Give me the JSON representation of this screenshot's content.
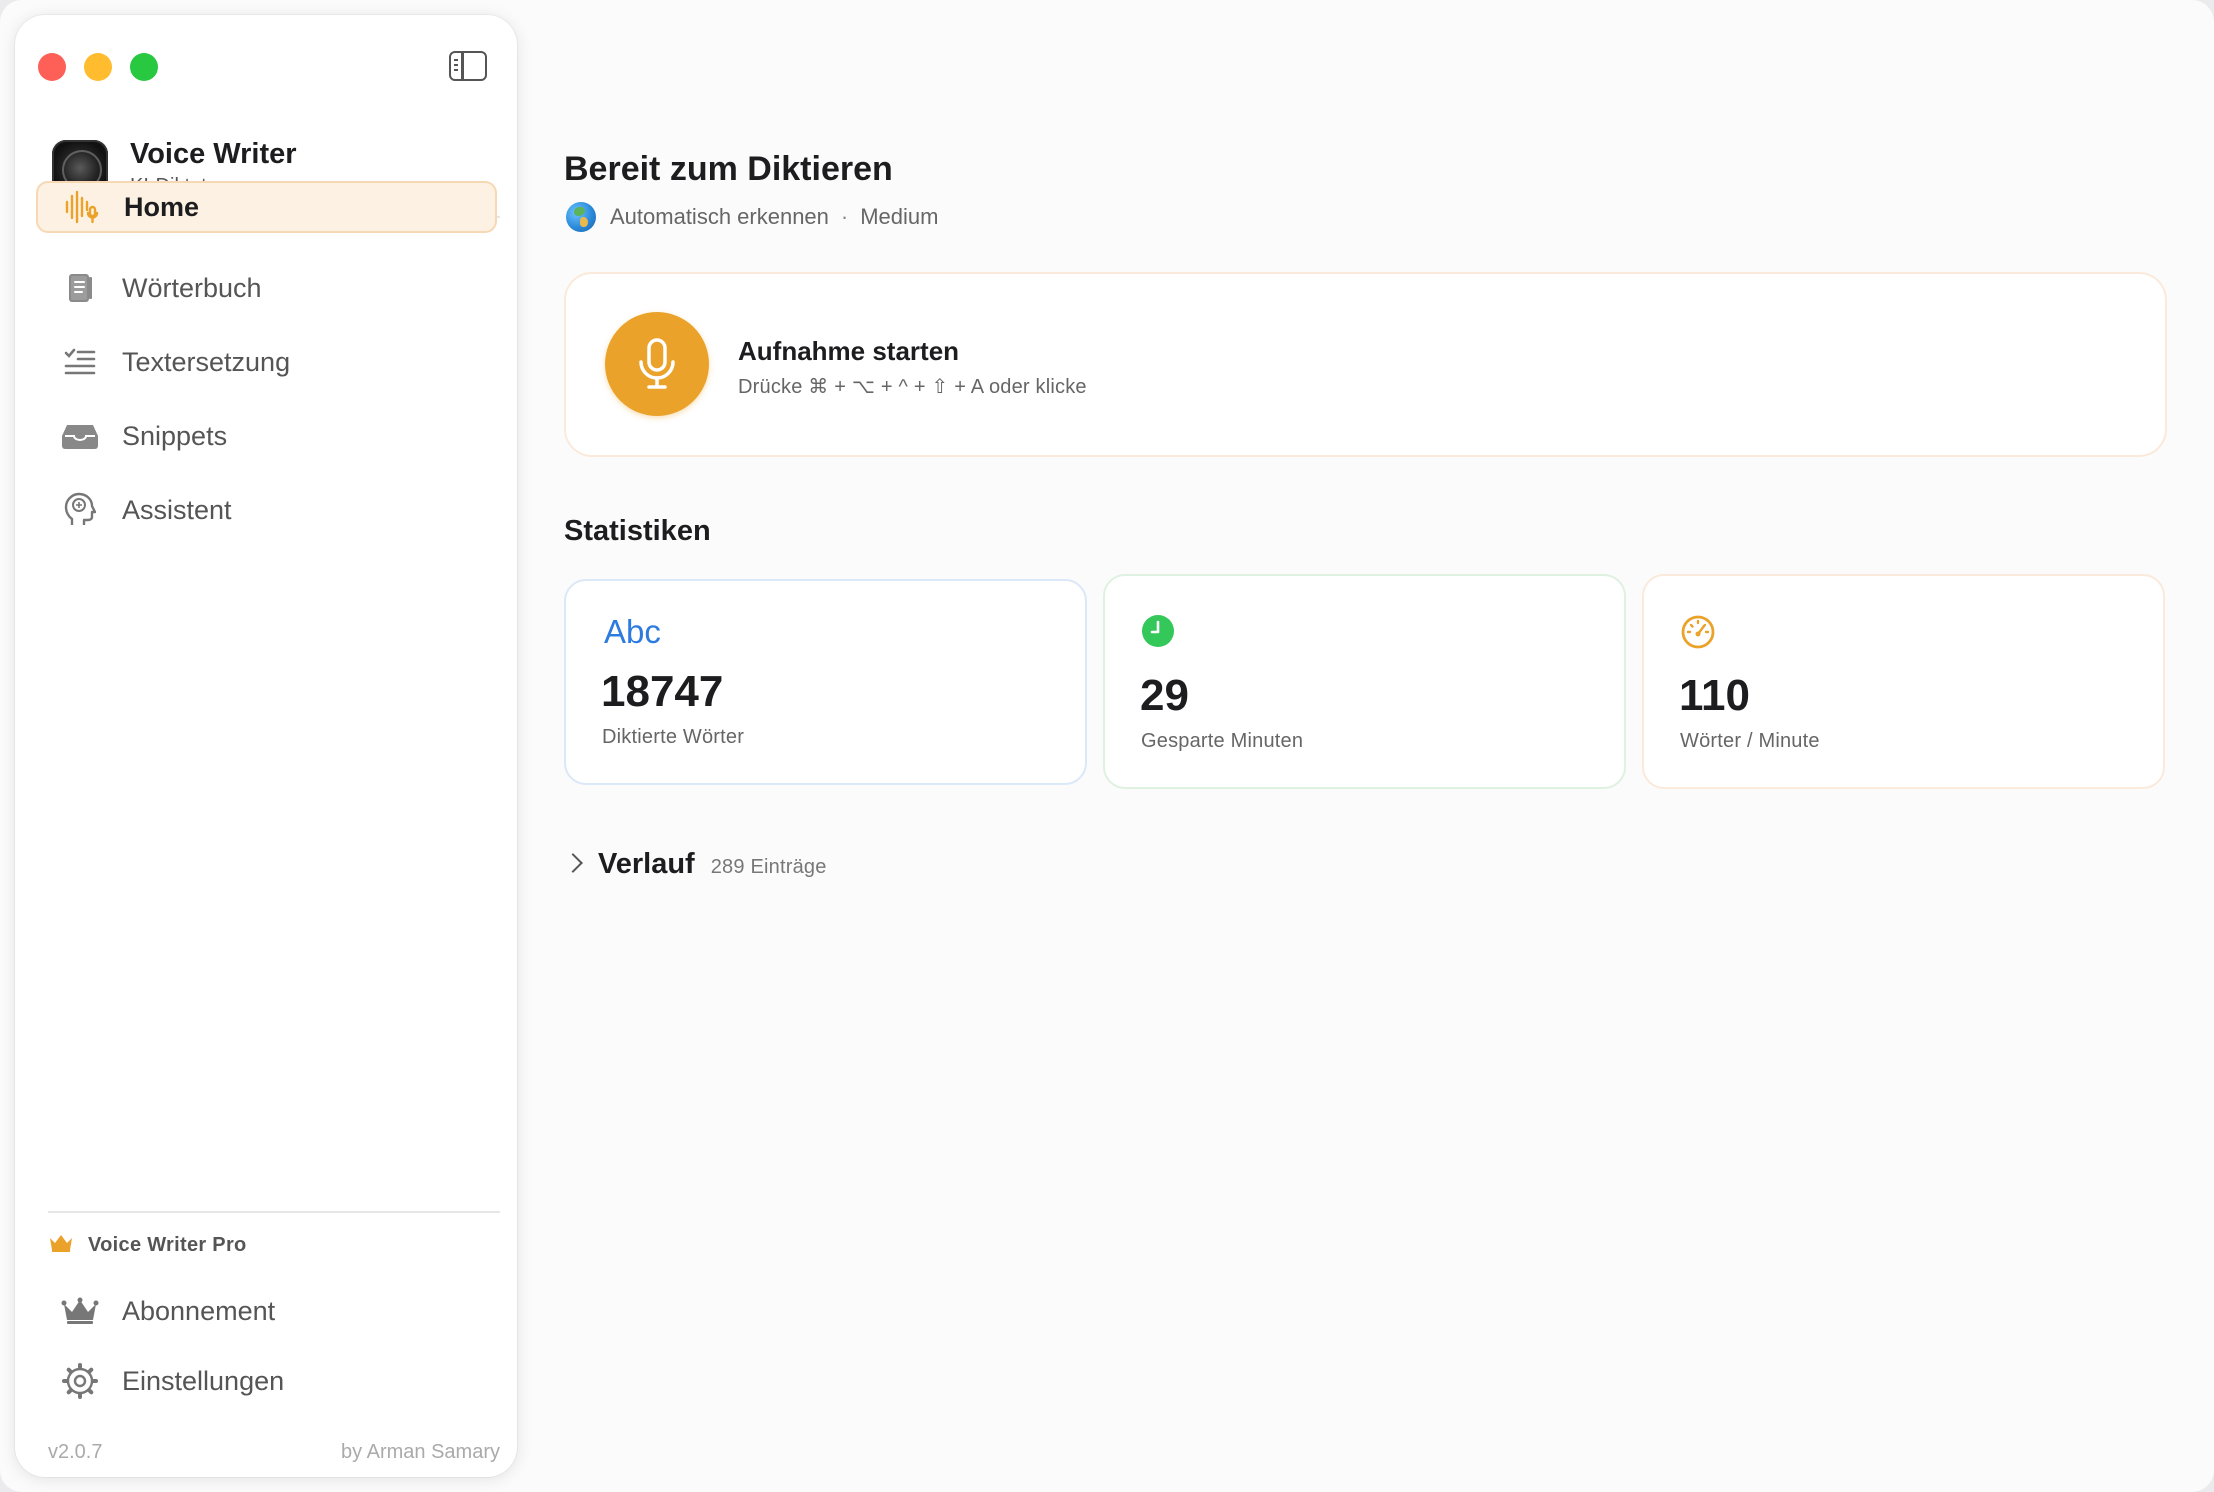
{
  "app": {
    "name": "Voice Writer",
    "subtitle": "KI-Diktat"
  },
  "sidebar": {
    "items": [
      {
        "label": "Home",
        "icon": "waveform-mic-icon",
        "active": true
      },
      {
        "label": "Wörterbuch",
        "icon": "book-icon"
      },
      {
        "label": "Textersetzung",
        "icon": "text-replace-icon"
      },
      {
        "label": "Snippets",
        "icon": "tray-icon"
      },
      {
        "label": "Assistent",
        "icon": "brain-head-icon"
      }
    ],
    "pro_label": "Voice Writer Pro",
    "bottom_items": [
      {
        "label": "Abonnement",
        "icon": "crown-icon"
      },
      {
        "label": "Einstellungen",
        "icon": "gear-icon"
      }
    ],
    "version": "v2.0.7",
    "author": "by Arman Samary"
  },
  "main": {
    "title": "Bereit zum Diktieren",
    "language": "Automatisch erkennen",
    "separator": "·",
    "model": "Medium",
    "record": {
      "title": "Aufnahme starten",
      "hint": "Drücke ⌘ + ⌥ + ^ + ⇧ + A oder klicke"
    },
    "stats_title": "Statistiken",
    "stats": [
      {
        "icon_text": "Abc",
        "value": "18747",
        "label": "Diktierte Wörter"
      },
      {
        "icon": "clock-icon",
        "value": "29",
        "label": "Gesparte Minuten"
      },
      {
        "icon": "speedometer-icon",
        "value": "110",
        "label": "Wörter / Minute"
      }
    ],
    "history": {
      "title": "Verlauf",
      "count": "289 Einträge"
    }
  },
  "colors": {
    "accent": "#eaa22a",
    "active_bg": "#fdf1e4",
    "blue": "#2e7be0",
    "green": "#34c759",
    "orange": "#eaa22a"
  }
}
